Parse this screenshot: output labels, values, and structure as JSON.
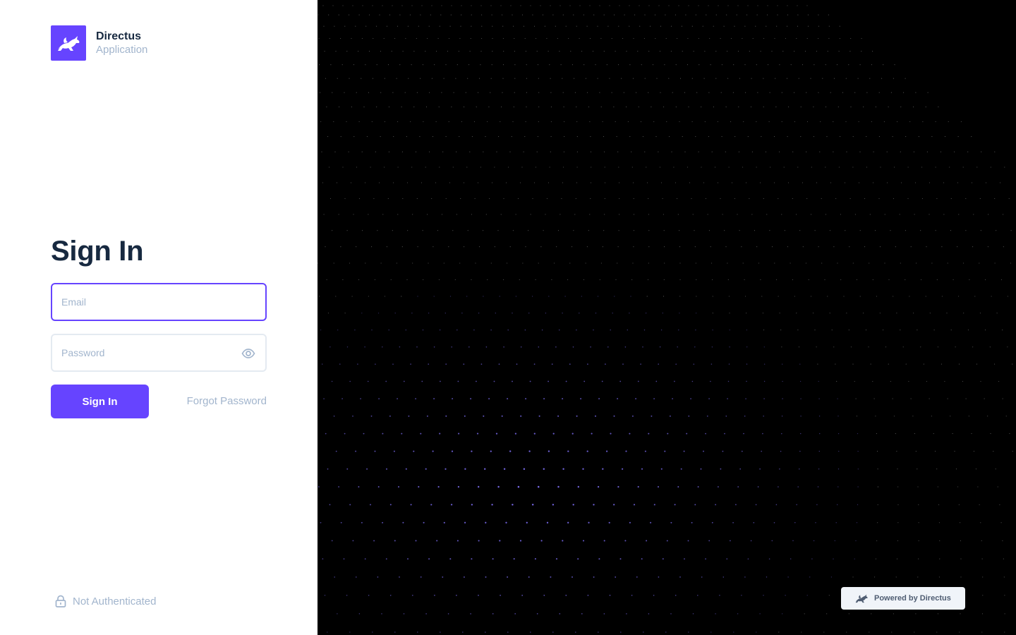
{
  "brand": {
    "name": "Directus",
    "subtitle": "Application",
    "logo_icon": "rabbit-logo-icon",
    "accent_color": "#6644ff"
  },
  "form": {
    "title": "Sign In",
    "email_placeholder": "Email",
    "password_placeholder": "Password",
    "submit_label": "Sign In",
    "forgot_label": "Forgot Password",
    "password_toggle_icon": "eye-icon"
  },
  "status": {
    "label": "Not Authenticated",
    "icon": "lock-icon"
  },
  "background": {
    "color": "#000000",
    "dot_color": "#7b6cf0"
  },
  "powered_by": {
    "label": "Powered by Directus",
    "icon": "rabbit-logo-icon"
  }
}
